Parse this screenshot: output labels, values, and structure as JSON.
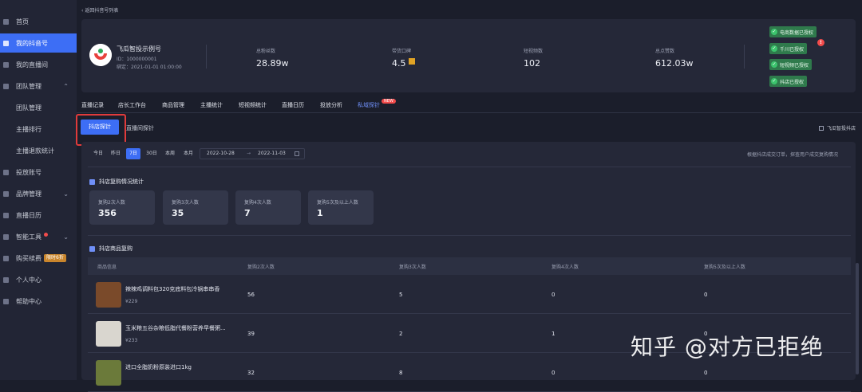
{
  "sidebar": {
    "items": [
      {
        "label": "首页",
        "icon": "home-icon"
      },
      {
        "label": "我的抖音号",
        "icon": "grid-icon",
        "active": true
      },
      {
        "label": "我的直播间",
        "icon": "live-icon"
      },
      {
        "label": "团队管理",
        "icon": "team-icon",
        "expanded": true
      },
      {
        "label": "团队管理",
        "sub": true
      },
      {
        "label": "主播排行",
        "sub": true
      },
      {
        "label": "主播退款统计",
        "sub": true
      },
      {
        "label": "投放账号",
        "icon": "send-icon"
      },
      {
        "label": "品牌管理",
        "icon": "brand-icon"
      },
      {
        "label": "直播日历",
        "icon": "calendar-icon"
      },
      {
        "label": "智能工具",
        "icon": "tool-icon"
      },
      {
        "label": "购买续费",
        "icon": "cart-icon",
        "badge": "限时6折"
      },
      {
        "label": "个人中心",
        "icon": "user-icon"
      },
      {
        "label": "帮助中心",
        "icon": "help-icon"
      }
    ]
  },
  "header": {
    "back_label": "返回抖音号列表"
  },
  "profile": {
    "name": "飞瓜智投示例号",
    "id_line": "ID：1000000001",
    "bind_line": "绑定：2021-01-01 01:00:00",
    "stats": [
      {
        "label": "总粉丝数",
        "value": "28.89w"
      },
      {
        "label": "带货口碑",
        "value": "4.5"
      },
      {
        "label": "短视频数",
        "value": "102"
      },
      {
        "label": "总点赞数",
        "value": "612.03w"
      }
    ],
    "auth": [
      "电商数据已授权",
      "千川已授权",
      "短视频已授权",
      "抖店已授权"
    ],
    "auth_color": "#2f7a4c"
  },
  "tabs": [
    "直播记录",
    "店长工作台",
    "商品管理",
    "主播统计",
    "短视频统计",
    "直播日历",
    "投放分析",
    "私域探针"
  ],
  "tab_new_badge": "NEW",
  "sub_tabs": {
    "active": "抖店探针",
    "other": "直播间探针"
  },
  "right_check_label": "飞瓜智投抖店",
  "date_filters": [
    "今日",
    "昨日",
    "7日",
    "30日",
    "本周",
    "本月"
  ],
  "date_range": {
    "start": "2022-10-28",
    "sep": "→",
    "end": "2022-11-03"
  },
  "hint": "根据抖店成交订单，探查用户成交复购情况",
  "repurchase": {
    "title": "抖店复购情况统计",
    "cards": [
      {
        "label": "复购2次人数",
        "value": "356"
      },
      {
        "label": "复购3次人数",
        "value": "35"
      },
      {
        "label": "复购4次人数",
        "value": "7"
      },
      {
        "label": "复购5次及以上人数",
        "value": "1"
      }
    ]
  },
  "goods": {
    "title": "抖店商品复购",
    "columns": [
      "商品信息",
      "复购2次人数",
      "复购3次人数",
      "复购4次人数",
      "复购5次及以上人数"
    ],
    "rows": [
      {
        "name": "辣辣鸡调料包320克底料包冷锅串串香",
        "price": "¥229",
        "c2": "56",
        "c3": "5",
        "c4": "0",
        "c5": "0"
      },
      {
        "name": "玉米粮五谷杂粮低脂代餐粉营养早餐粥...",
        "price": "¥233",
        "c2": "39",
        "c3": "2",
        "c4": "1",
        "c5": "0"
      },
      {
        "name": "进口全脂奶粉原装进口1kg",
        "price": "",
        "c2": "32",
        "c3": "8",
        "c4": "0",
        "c5": "0"
      }
    ]
  },
  "watermark": "知乎 @对方已拒绝",
  "accent_color": "#3d6ef5"
}
